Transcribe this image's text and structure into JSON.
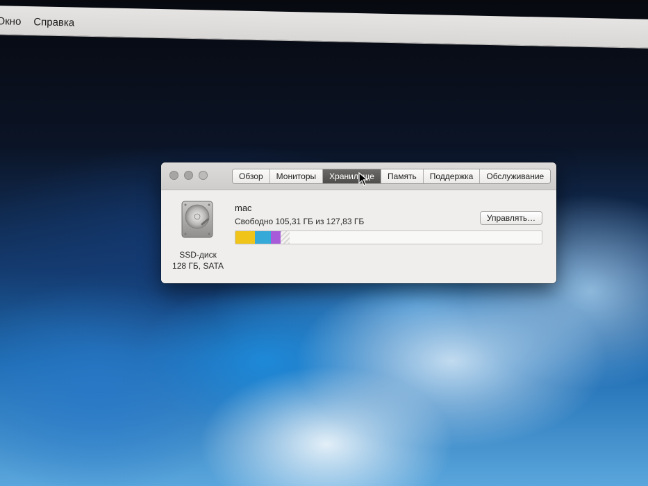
{
  "menubar": {
    "items": [
      "Окно",
      "Справка"
    ]
  },
  "window": {
    "tabs": [
      {
        "label": "Обзор",
        "active": false
      },
      {
        "label": "Мониторы",
        "active": false
      },
      {
        "label": "Хранилище",
        "active": true
      },
      {
        "label": "Память",
        "active": false
      },
      {
        "label": "Поддержка",
        "active": false
      },
      {
        "label": "Обслуживание",
        "active": false
      }
    ],
    "disk": {
      "name": "SSD-диск",
      "spec": "128 ГБ, SATA"
    },
    "volume": {
      "name": "mac",
      "free_text": "Свободно 105,31 ГБ из 127,83 ГБ",
      "free_gb": 105.31,
      "total_gb": 127.83
    },
    "manage_button": "Управлять…",
    "storage_segments": [
      {
        "category": "yellow",
        "color": "#f0c419",
        "fraction": 0.063
      },
      {
        "category": "cyan",
        "color": "#35a9d8",
        "fraction": 0.052
      },
      {
        "category": "purple",
        "color": "#a85bd8",
        "fraction": 0.033
      },
      {
        "category": "other",
        "color": "#d7d5d3",
        "fraction": 0.03
      }
    ]
  },
  "colors": {
    "active_tab": "#55534f",
    "window_bg": "#efeeec"
  }
}
